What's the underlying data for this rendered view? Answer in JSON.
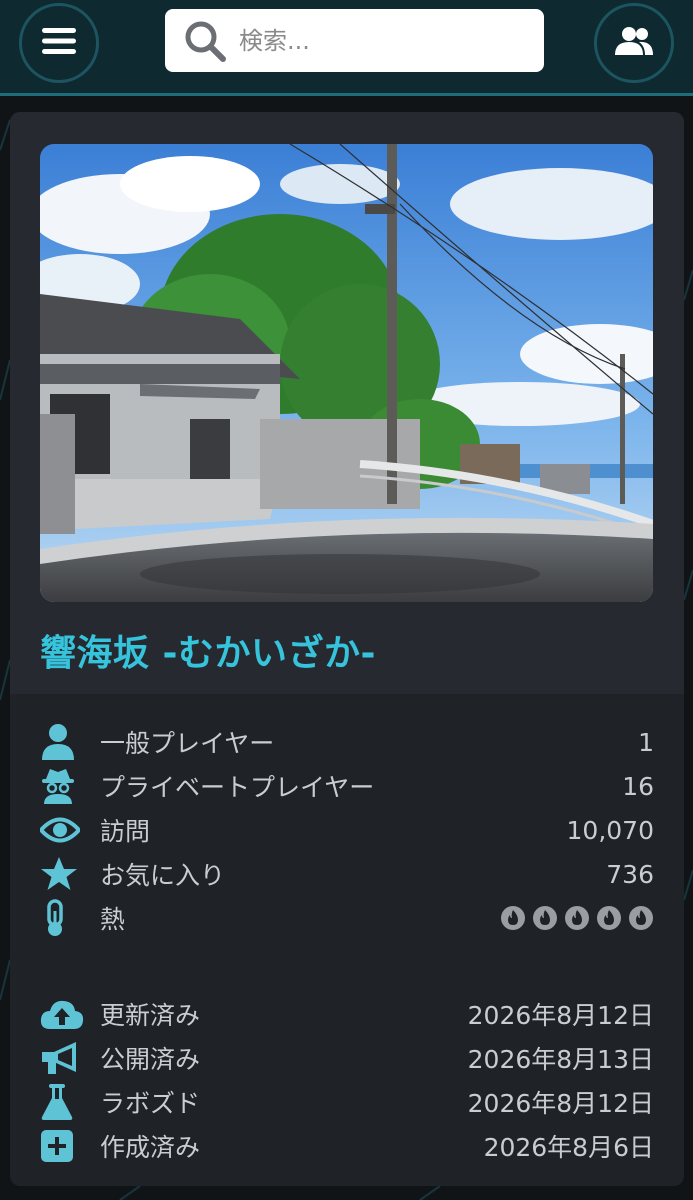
{
  "header": {
    "menu_icon": "hamburger-icon",
    "search": {
      "placeholder": "検索...",
      "value": ""
    },
    "users_icon": "users-icon"
  },
  "world": {
    "title": "響海坂 -むかいざか-",
    "thumbnail": "street-scene-image"
  },
  "stats": [
    {
      "icon": "user-icon",
      "label": "一般プレイヤー",
      "value": "1"
    },
    {
      "icon": "spy-icon",
      "label": "プライベートプレイヤー",
      "value": "16"
    },
    {
      "icon": "eye-icon",
      "label": "訪問",
      "value": "10,070"
    },
    {
      "icon": "star-icon",
      "label": "お気に入り",
      "value": "736"
    },
    {
      "icon": "thermometer-icon",
      "label": "熱",
      "heat_level": 5,
      "heat_max": 5
    }
  ],
  "dates": [
    {
      "icon": "cloud-upload-icon",
      "label": "更新済み",
      "value": "2026年8月12日"
    },
    {
      "icon": "megaphone-icon",
      "label": "公開済み",
      "value": "2026年8月13日"
    },
    {
      "icon": "flask-icon",
      "label": "ラボズド",
      "value": "2026年8月12日"
    },
    {
      "icon": "plus-square-icon",
      "label": "作成済み",
      "value": "2026年8月6日"
    }
  ],
  "colors": {
    "accent": "#36c3dc",
    "header_bg": "#0e2a30",
    "card_bg": "#1f2226",
    "icon": "#5fc3d6",
    "heat_icon": "#9a9da1"
  }
}
